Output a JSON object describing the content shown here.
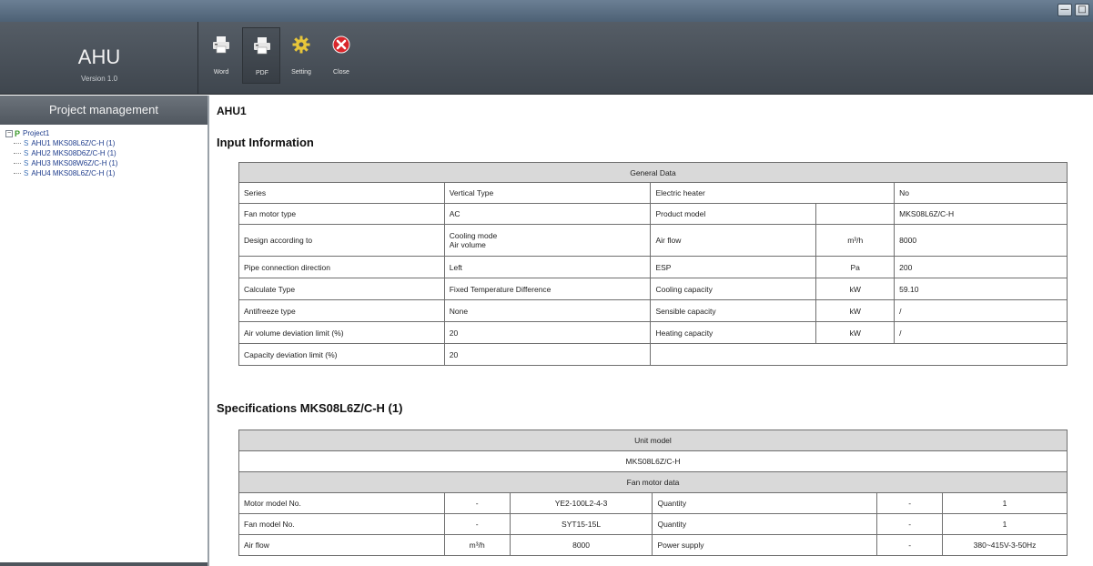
{
  "window": {
    "minimize_glyph": "—",
    "maximize_glyph": "□"
  },
  "brand": {
    "app_name": "AHU",
    "version": "Version 1.0"
  },
  "toolbar": [
    {
      "label": "Word",
      "icon": "printer-icon"
    },
    {
      "label": "PDF",
      "icon": "printer-icon"
    },
    {
      "label": "Setting",
      "icon": "gear-icon"
    },
    {
      "label": "Close",
      "icon": "close-circle-icon"
    }
  ],
  "sidebar": {
    "title": "Project management",
    "project": "Project1",
    "items": [
      "AHU1 MKS08L6Z/C-H (1)",
      "AHU2 MKS08D6Z/C-H (1)",
      "AHU3 MKS08W6Z/C-H (1)",
      "AHU4 MKS08L6Z/C-H (1)"
    ]
  },
  "report": {
    "title": "AHU1",
    "input_title": "Input Information",
    "general": {
      "header": "General Data",
      "rows": [
        [
          "Series",
          "Vertical Type",
          "Electric heater",
          "",
          "No"
        ],
        [
          "Fan motor type",
          "AC",
          "Product model",
          "",
          "MKS08L6Z/C-H"
        ],
        [
          "Design according to",
          "Cooling mode\nAir volume",
          "Air flow",
          "m³/h",
          "8000"
        ],
        [
          "Pipe connection direction",
          "Left",
          "ESP",
          "Pa",
          "200"
        ],
        [
          "Calculate Type",
          "Fixed Temperature Difference",
          "Cooling capacity",
          "kW",
          "59.10"
        ],
        [
          "Antifreeze type",
          "None",
          "Sensible capacity",
          "kW",
          "/"
        ],
        [
          "Air volume deviation limit (%)",
          "20",
          "Heating capacity",
          "kW",
          "/"
        ],
        [
          "Capacity deviation limit (%)",
          "20",
          "",
          "",
          ""
        ]
      ]
    },
    "spec_title": "Specifications MKS08L6Z/C-H (1)",
    "spec": {
      "unit_model_header": "Unit model",
      "unit_model_value": "MKS08L6Z/C-H",
      "fan_motor_header": "Fan motor data",
      "rows": [
        [
          "Motor model No.",
          "-",
          "YE2-100L2-4-3",
          "Quantity",
          "-",
          "1"
        ],
        [
          "Fan model No.",
          "-",
          "SYT15-15L",
          "Quantity",
          "-",
          "1"
        ],
        [
          "Air flow",
          "m³/h",
          "8000",
          "Power supply",
          "-",
          "380~415V-3-50Hz"
        ]
      ]
    }
  }
}
